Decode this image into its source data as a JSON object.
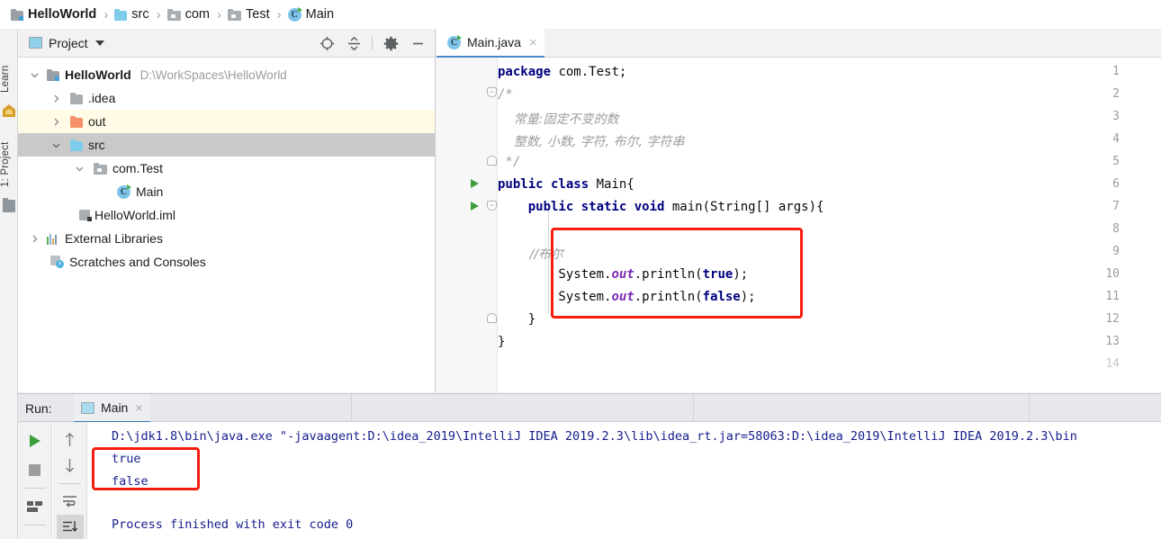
{
  "breadcrumb": {
    "items": [
      {
        "label": "HelloWorld",
        "icon": "folder-module-icon",
        "bold": true
      },
      {
        "label": "src",
        "icon": "folder-source-icon",
        "bold": false
      },
      {
        "label": "com",
        "icon": "package-icon",
        "bold": false
      },
      {
        "label": "Test",
        "icon": "package-icon",
        "bold": false
      },
      {
        "label": "Main",
        "icon": "java-class-icon",
        "bold": false
      }
    ],
    "separator": "›"
  },
  "left_strip": {
    "tabs": [
      {
        "label": "Learn",
        "icon": "learn-icon"
      },
      {
        "label": "1: Project",
        "icon": "project-icon"
      }
    ]
  },
  "project_panel": {
    "title": "Project",
    "actions": [
      {
        "name": "locate-icon",
        "title": "Select Opened File"
      },
      {
        "name": "collapse-all-icon",
        "title": "Collapse All"
      },
      {
        "name": "gear-icon",
        "title": "Settings"
      },
      {
        "name": "minimize-icon",
        "title": "Hide"
      }
    ],
    "tree": [
      {
        "label": "HelloWorld",
        "path": "D:\\WorkSpaces\\HelloWorld",
        "icon": "folder-module-icon",
        "indent": 0,
        "arrow": "down",
        "bold": true,
        "highlight": "none"
      },
      {
        "label": ".idea",
        "path": "",
        "icon": "folder-gray-icon",
        "indent": 1,
        "arrow": "right",
        "bold": false,
        "highlight": "none"
      },
      {
        "label": "out",
        "path": "",
        "icon": "folder-orange-icon",
        "indent": 1,
        "arrow": "right",
        "bold": false,
        "highlight": "yellow"
      },
      {
        "label": "src",
        "path": "",
        "icon": "folder-blue-icon",
        "indent": 1,
        "arrow": "down",
        "bold": false,
        "highlight": "gray"
      },
      {
        "label": "com.Test",
        "path": "",
        "icon": "package-icon",
        "indent": 2,
        "arrow": "down",
        "bold": false,
        "highlight": "none"
      },
      {
        "label": "Main",
        "path": "",
        "icon": "java-class-icon",
        "indent": 3,
        "arrow": "none",
        "bold": false,
        "highlight": "none"
      },
      {
        "label": "HelloWorld.iml",
        "path": "",
        "icon": "iml-file-icon",
        "indent": 2,
        "arrow": "none",
        "bold": false,
        "highlight": "none"
      },
      {
        "label": "External Libraries",
        "path": "",
        "icon": "libraries-icon",
        "indent": 0,
        "arrow": "right",
        "bold": false,
        "highlight": "none"
      },
      {
        "label": "Scratches and Consoles",
        "path": "",
        "icon": "scratches-icon",
        "indent": 1,
        "arrow": "none",
        "bold": false,
        "highlight": "none"
      }
    ]
  },
  "editor": {
    "tab": {
      "label": "Main.java",
      "icon": "java-class-icon",
      "close": "×"
    },
    "lines": [
      {
        "num": "1",
        "gutter_run": false,
        "fold": "none",
        "segments": [
          {
            "t": "package ",
            "c": "kw"
          },
          {
            "t": "com.Test;",
            "c": "plain"
          }
        ]
      },
      {
        "num": "2",
        "gutter_run": false,
        "fold": "top",
        "segments": [
          {
            "t": "/*",
            "c": "cmt"
          }
        ]
      },
      {
        "num": "3",
        "gutter_run": false,
        "fold": "none",
        "segments": [
          {
            "t": "    常量:固定不变的数",
            "c": "cmt-cn"
          }
        ]
      },
      {
        "num": "4",
        "gutter_run": false,
        "fold": "none",
        "segments": [
          {
            "t": "    整数, 小数, 字符, 布尔, 字符串",
            "c": "cmt-cn"
          }
        ]
      },
      {
        "num": "5",
        "gutter_run": false,
        "fold": "bot",
        "segments": [
          {
            "t": " */",
            "c": "cmt"
          }
        ]
      },
      {
        "num": "6",
        "gutter_run": true,
        "fold": "none",
        "segments": [
          {
            "t": "public class ",
            "c": "kw"
          },
          {
            "t": "Main{",
            "c": "plain"
          }
        ]
      },
      {
        "num": "7",
        "gutter_run": true,
        "fold": "top",
        "segments": [
          {
            "t": "    public static void ",
            "c": "kw"
          },
          {
            "t": "main(String[] args){",
            "c": "plain"
          }
        ]
      },
      {
        "num": "8",
        "gutter_run": false,
        "fold": "none",
        "segments": []
      },
      {
        "num": "9",
        "gutter_run": false,
        "fold": "none",
        "segments": [
          {
            "t": "        //布尔",
            "c": "cmt-cn"
          }
        ]
      },
      {
        "num": "10",
        "gutter_run": false,
        "fold": "none",
        "segments": [
          {
            "t": "        System.",
            "c": "plain"
          },
          {
            "t": "out",
            "c": "field-static"
          },
          {
            "t": ".println(",
            "c": "plain"
          },
          {
            "t": "true",
            "c": "kw"
          },
          {
            "t": ");",
            "c": "plain"
          }
        ]
      },
      {
        "num": "11",
        "gutter_run": false,
        "fold": "none",
        "segments": [
          {
            "t": "        System.",
            "c": "plain"
          },
          {
            "t": "out",
            "c": "field-static"
          },
          {
            "t": ".println(",
            "c": "plain"
          },
          {
            "t": "false",
            "c": "kw"
          },
          {
            "t": ");",
            "c": "plain"
          }
        ]
      },
      {
        "num": "12",
        "gutter_run": false,
        "fold": "bot",
        "segments": [
          {
            "t": "    }",
            "c": "plain"
          }
        ]
      },
      {
        "num": "13",
        "gutter_run": false,
        "fold": "none",
        "segments": [
          {
            "t": "}",
            "c": "plain"
          }
        ]
      },
      {
        "num": "14",
        "gutter_run": false,
        "fold": "none",
        "segments": []
      }
    ],
    "annotation_box_color": "#f81c0e"
  },
  "run_panel": {
    "run_label": "Run:",
    "tab": {
      "label": "Main",
      "icon": "run-window-icon",
      "close": "×"
    },
    "tools": [
      {
        "name": "rerun-icon"
      },
      {
        "name": "stop-icon"
      },
      {
        "name": "layout-icon"
      }
    ],
    "tools2": [
      {
        "name": "up-arrow-icon",
        "glyph": "↑"
      },
      {
        "name": "down-arrow-icon",
        "glyph": "↓"
      },
      {
        "name": "soft-wrap-icon"
      },
      {
        "name": "scroll-to-end-icon"
      }
    ],
    "console_lines": [
      "D:\\jdk1.8\\bin\\java.exe \"-javaagent:D:\\idea_2019\\IntelliJ IDEA 2019.2.3\\lib\\idea_rt.jar=58063:D:\\idea_2019\\IntelliJ IDEA 2019.2.3\\bin",
      "true",
      "false",
      "",
      "Process finished with exit code 0"
    ],
    "annotation_box_color": "#f81c0e"
  },
  "colors": {
    "accent_blue": "#4a86c8",
    "keyword": "#00007f",
    "comment_gray": "#9d9d9d",
    "static_field_purple": "#7a2ab5",
    "console_text": "#151c8c",
    "highlight_red": "#f81c0e",
    "selection_gray": "#c9c9c9",
    "highlight_yellow": "#fffbe6"
  }
}
